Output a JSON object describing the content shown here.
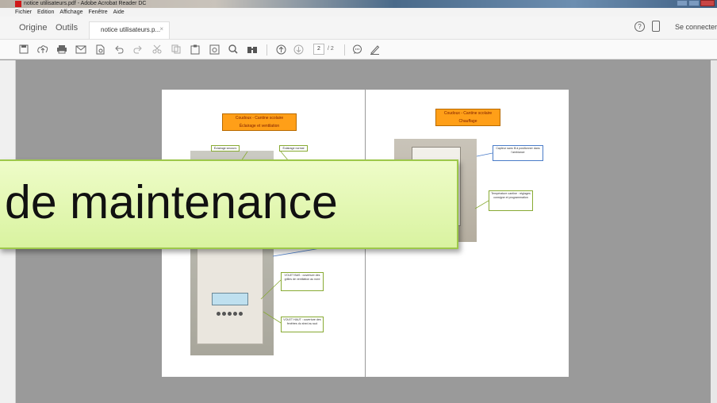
{
  "window": {
    "title": "notice utilisateurs.pdf - Adobe Acrobat Reader DC"
  },
  "menu": [
    "Fichier",
    "Edition",
    "Affichage",
    "Fenêtre",
    "Aide"
  ],
  "tabs": {
    "home": "Origine",
    "tools": "Outils",
    "document": "notice utilisateurs.p...",
    "close": "×"
  },
  "header": {
    "help": "?",
    "signin": "Se connecter"
  },
  "toolbar": {
    "current_page": "2",
    "total_pages": "/ 2"
  },
  "page_left": {
    "title_line1": "Coudoux - Cantine scolaire",
    "title_line2": "Éclairage et ventilation",
    "callout_1": "Éclairage secours",
    "callout_2": "Éclairage normal",
    "callout_3": "VOLET BAS : ouverture des grilles de ventilation au nord",
    "callout_4": "VOLET HAUT : ouverture des fenêtres du shed au sud"
  },
  "page_right": {
    "title_line1": "Coudoux - Cantine scolaire",
    "title_line2": "Chauffage",
    "callout_1": "Capteur sans fil à positionner dans l'ambiance",
    "callout_2": "Température cantine : réglages consigne et programmation"
  },
  "overlay": {
    "text": "de maintenance"
  }
}
